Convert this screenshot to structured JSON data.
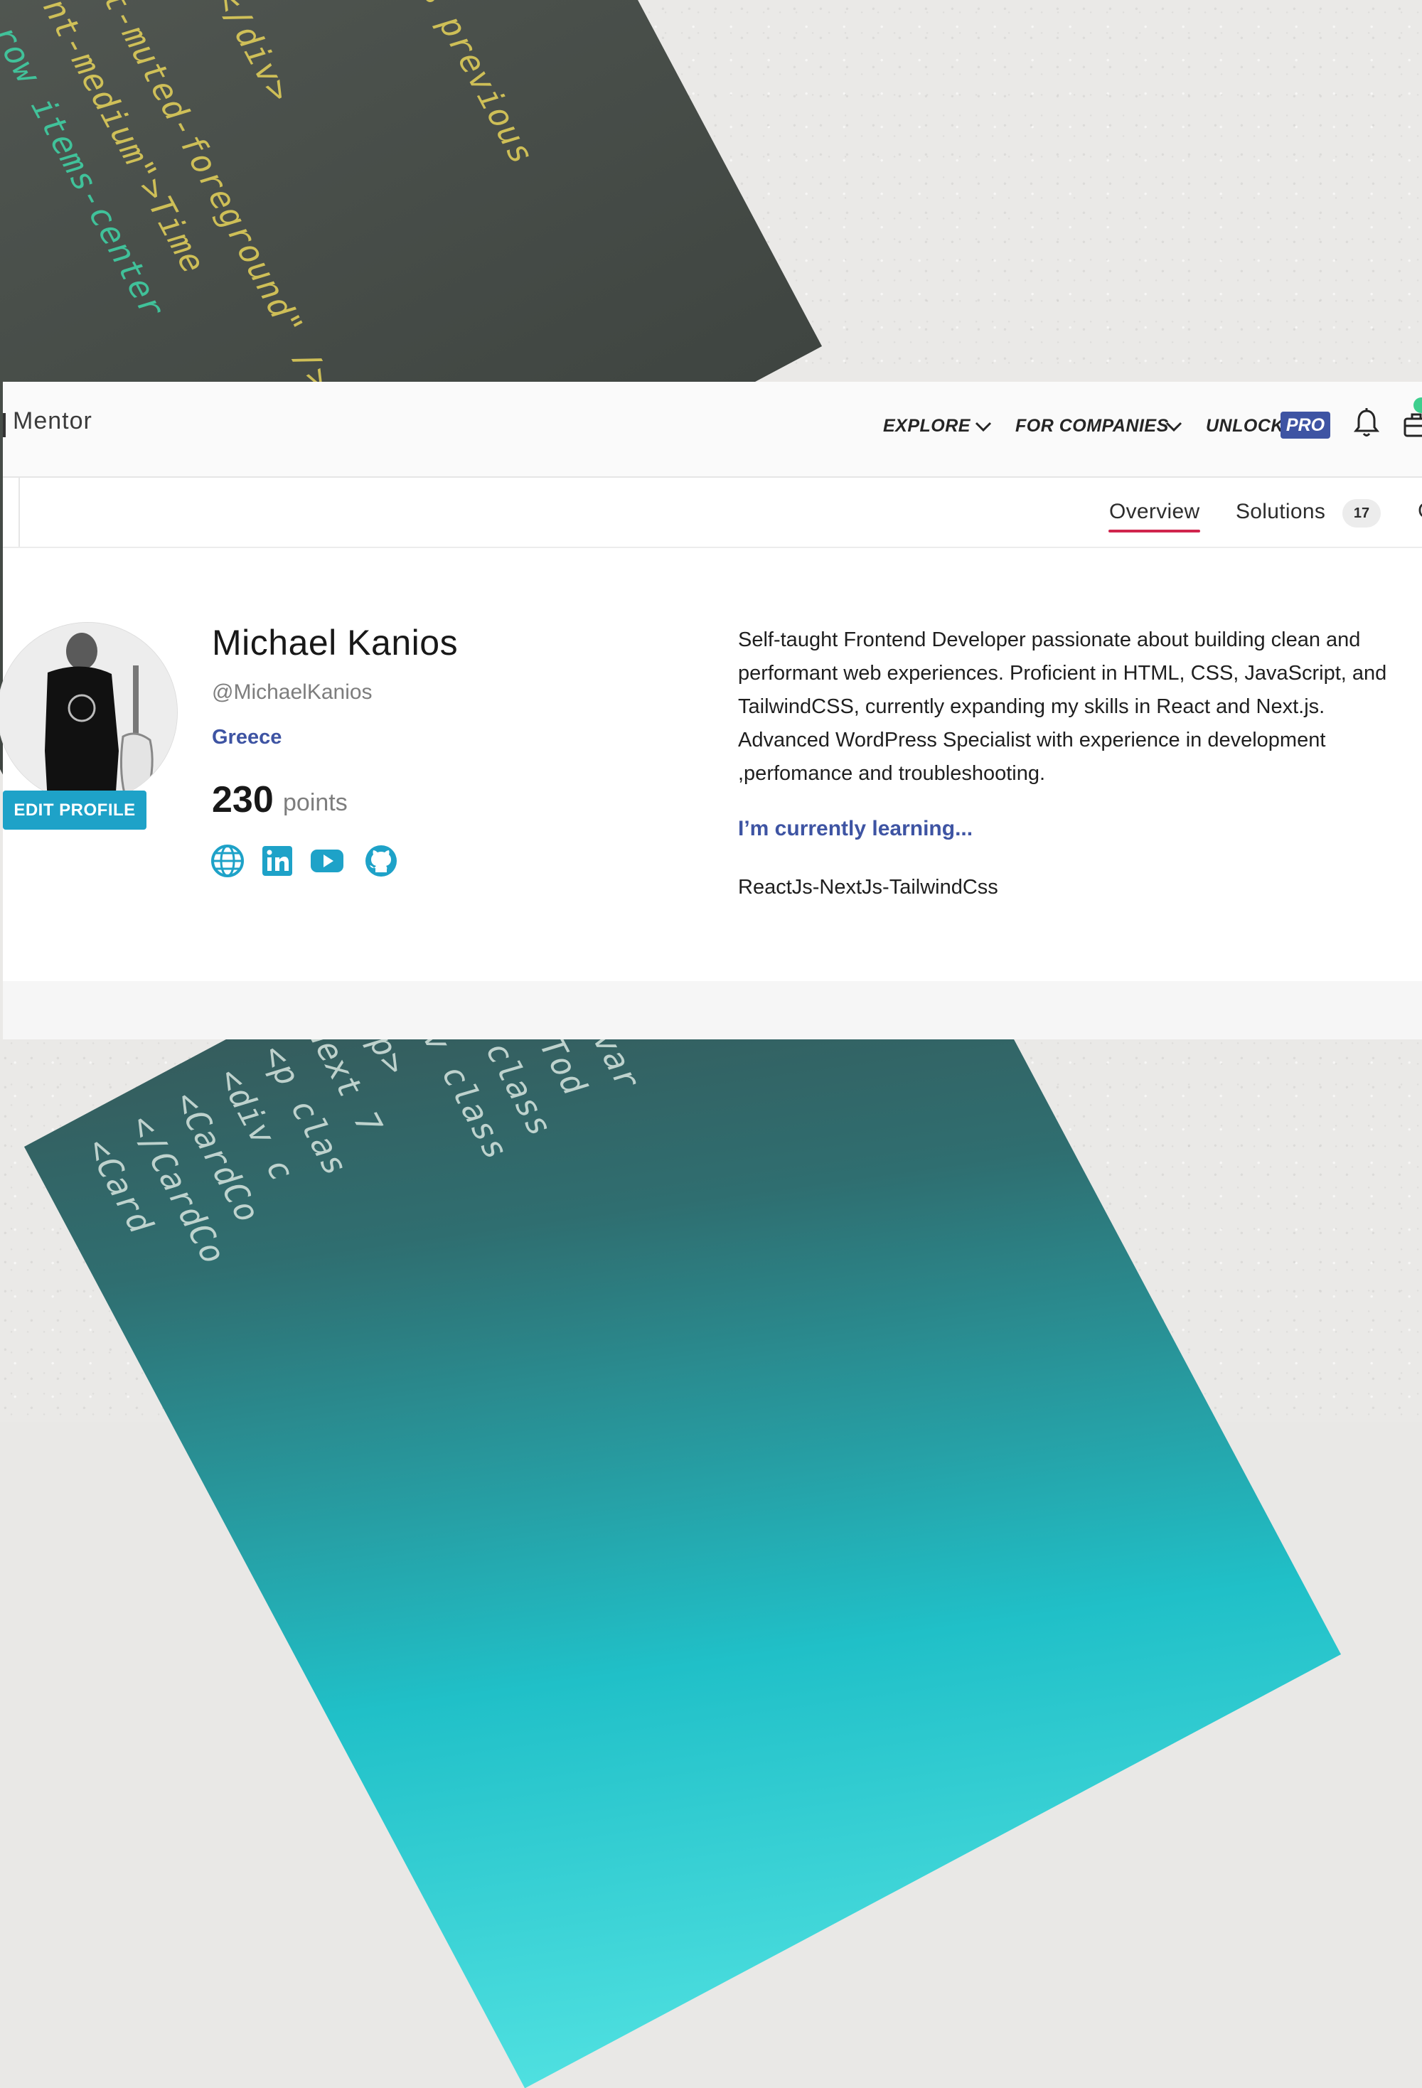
{
  "nav": {
    "brand": "Mentor",
    "explore": "EXPLORE",
    "for_companies": "FOR COMPANIES",
    "unlock": "UNLOCK",
    "pro": "PRO"
  },
  "tabs": {
    "overview": "Overview",
    "solutions": "Solutions",
    "solutions_count": "17",
    "cut": "C"
  },
  "profile": {
    "edit_button": "EDIT PROFILE",
    "name": "Michael Kanios",
    "handle": "@MichaelKanios",
    "country": "Greece",
    "points_value": "230",
    "points_label": "points",
    "bio_lines": [
      "Self-taught Frontend Developer passionate about building clean and",
      "performant web experiences. Proficient in HTML, CSS, JavaScript, and",
      "TailwindCSS, currently expanding my skills in React and Next.js.",
      "Advanced WordPress Specialist with experience in development",
      ",perfomance and troubleshooting."
    ],
    "learning_heading": "I’m currently learning...",
    "learning_text": "ReactJs-NextJs-TailwindCss"
  },
  "icons": {
    "website": "globe-icon",
    "linkedin": "linkedin-icon",
    "youtube": "youtube-icon",
    "github": "github-icon",
    "bell": "bell-icon",
    "bag": "briefcase-icon"
  },
  "colors": {
    "accent_blue": "#3e54a3",
    "edit_button": "#1ea2c8",
    "tab_underline": "#d0254d",
    "social": "#1ea2c8"
  }
}
